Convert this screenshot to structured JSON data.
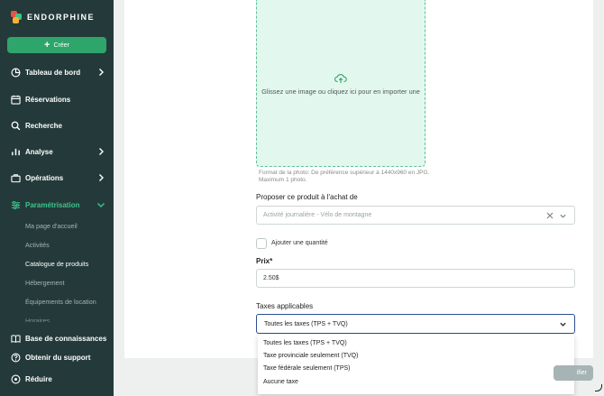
{
  "app": {
    "name": "ENDORPHINE",
    "brand_color": "#2ea56a",
    "sidebar_bg": "#243a3a",
    "active_color": "#3cc48a"
  },
  "sidebar": {
    "create_label": "Créer",
    "items": [
      {
        "label": "Tableau de bord",
        "icon": "pie-chart-icon",
        "has_chevron": true
      },
      {
        "label": "Réservations",
        "icon": "calendar-icon",
        "has_chevron": false
      },
      {
        "label": "Recherche",
        "icon": "search-icon",
        "has_chevron": false
      },
      {
        "label": "Analyse",
        "icon": "bar-chart-icon",
        "has_chevron": true
      },
      {
        "label": "Opérations",
        "icon": "briefcase-icon",
        "has_chevron": true
      },
      {
        "label": "Paramétrisation",
        "icon": "sliders-icon",
        "has_chevron": true,
        "expanded": true
      }
    ],
    "subitems": [
      {
        "label": "Ma page d'accueil"
      },
      {
        "label": "Activités"
      },
      {
        "label": "Catalogue de produits",
        "current": true
      },
      {
        "label": "Hébergement"
      },
      {
        "label": "Équipements de location"
      },
      {
        "label": "Horaires"
      }
    ],
    "bottom_items": [
      {
        "label": "Base de connaissances",
        "icon": "book-icon"
      },
      {
        "label": "Obtenir du support",
        "icon": "help-circle-icon"
      },
      {
        "label": "Réduire",
        "icon": "eye-icon"
      }
    ]
  },
  "form": {
    "upload_text": "Glissez une image ou cliquez ici pour en importer une",
    "photo_hint": "Format de la photo: De préférence supérieur à 1440x960 en JPG. Maximum 1 photo.",
    "propose_label": "Proposer ce produit à l'achat de",
    "propose_value": "Activité journalière - Vélo de montagne",
    "quantity_label": "Ajouter une quantité",
    "price_label": "Prix*",
    "price_value": "2.50$",
    "taxes_label": "Taxes applicables",
    "taxes_value": "Toutes les taxes (TPS + TVQ)",
    "tax_options": [
      "Toutes les taxes (TPS + TVQ)",
      "Taxe provinciale seulement (TVQ)",
      "Taxe fédérale seulement (TPS)",
      "Aucune taxe"
    ],
    "save_label": "ifier"
  }
}
